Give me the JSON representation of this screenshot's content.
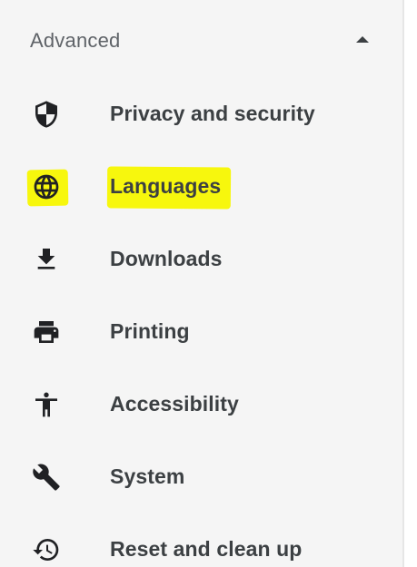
{
  "section": {
    "title": "Advanced",
    "expanded": true,
    "chevron_icon": "chevron-up-icon"
  },
  "highlight_color": "#f7f700",
  "menu": [
    {
      "label": "Privacy and security",
      "icon": "shield-icon"
    },
    {
      "label": "Languages",
      "icon": "globe-icon",
      "highlighted": true
    },
    {
      "label": "Downloads",
      "icon": "download-icon"
    },
    {
      "label": "Printing",
      "icon": "printer-icon"
    },
    {
      "label": "Accessibility",
      "icon": "accessibility-icon"
    },
    {
      "label": "System",
      "icon": "wrench-icon"
    },
    {
      "label": "Reset and clean up",
      "icon": "restore-icon"
    }
  ]
}
